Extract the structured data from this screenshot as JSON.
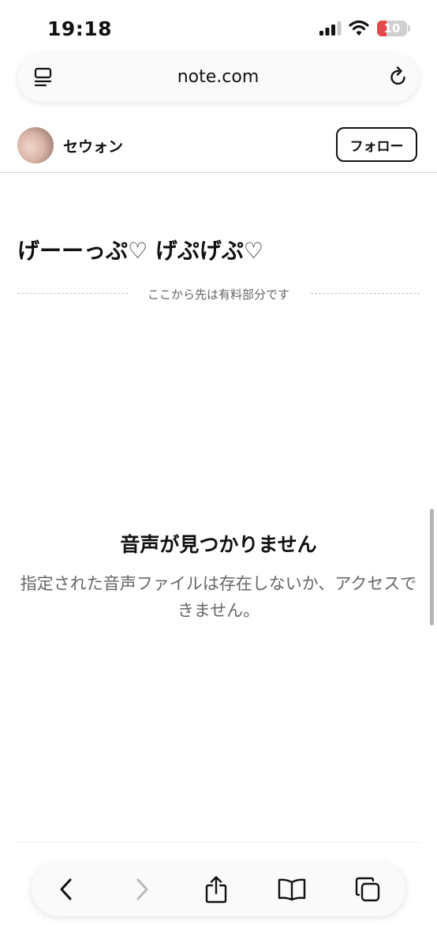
{
  "status_bar": {
    "time": "19:18",
    "battery_level": "10",
    "battery_color": "#e14a4a"
  },
  "browser": {
    "url": "note.com",
    "icons": {
      "reader": "reader-mode-icon",
      "reload": "reload-icon"
    }
  },
  "author": {
    "name": "セウォン",
    "follow_label": "フォロー"
  },
  "article": {
    "title": "げーーっぷ♡ げぷげぷ♡",
    "paywall_label": "ここから先は有料部分です"
  },
  "audio_error": {
    "title": "音声が見つかりません",
    "message": "指定された音声ファイルは存在しないか、アクセスできません。"
  },
  "toolbar": {
    "icons": [
      "back-icon",
      "forward-icon",
      "share-icon",
      "bookmarks-icon",
      "tabs-icon"
    ],
    "forward_enabled": false
  }
}
